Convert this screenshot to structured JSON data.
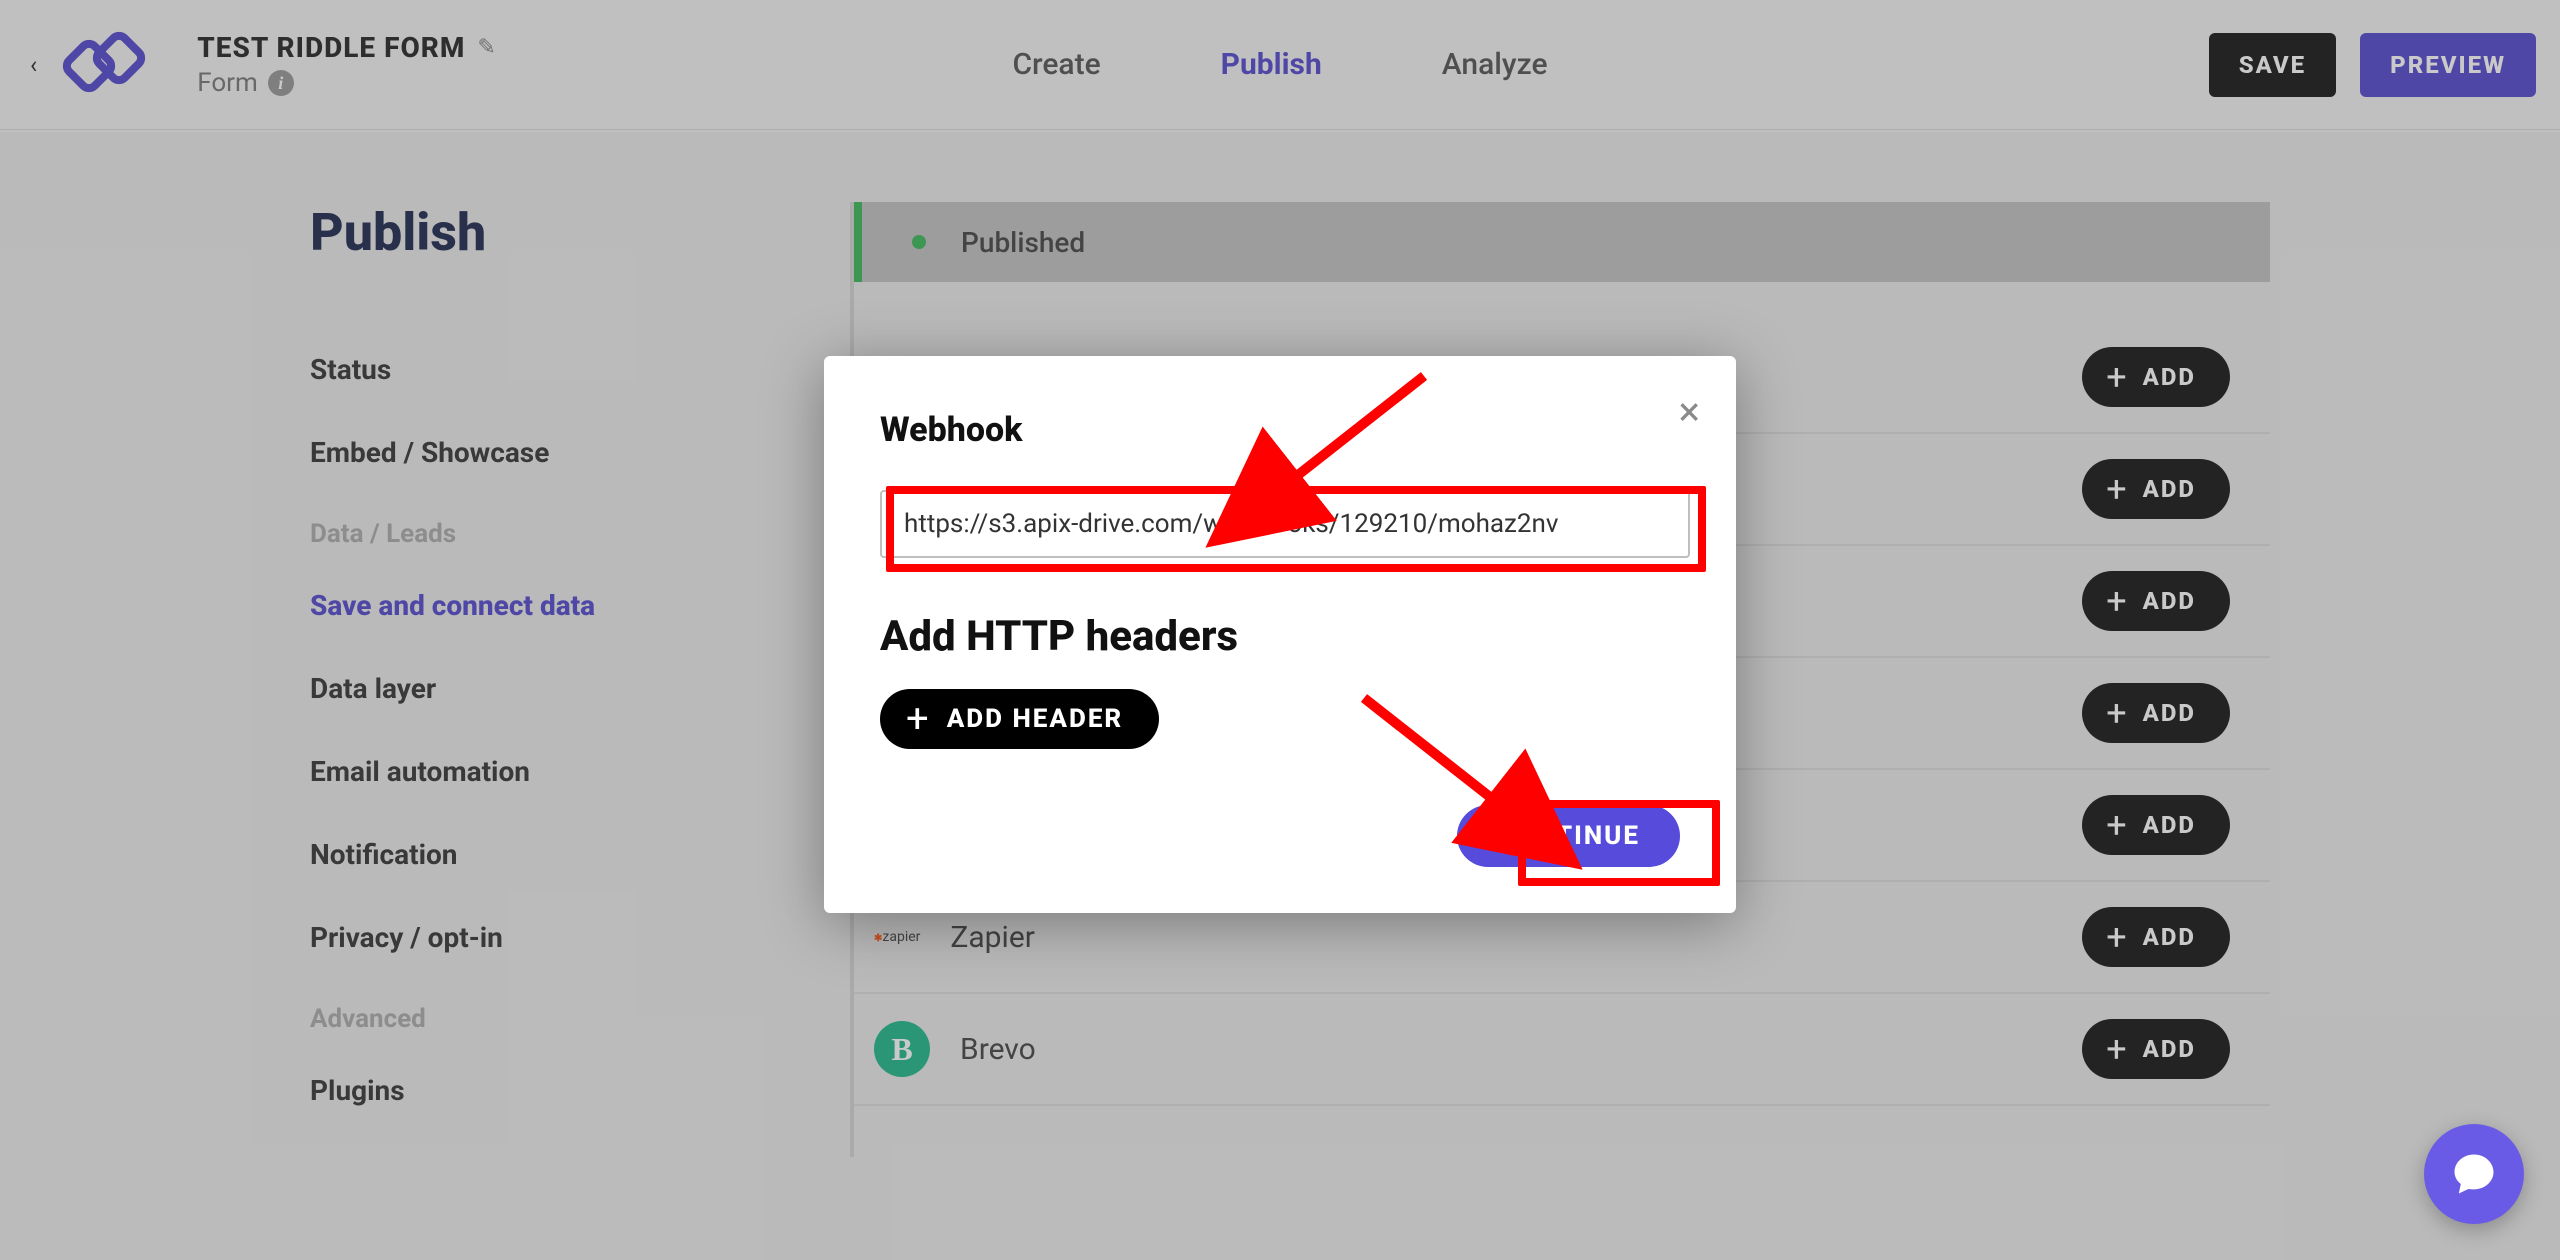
{
  "header": {
    "form_title": "TEST RIDDLE FORM",
    "form_type": "Form",
    "tabs": {
      "create": "Create",
      "publish": "Publish",
      "analyze": "Analyze"
    },
    "save": "SAVE",
    "preview": "PREVIEW"
  },
  "page_title": "Publish",
  "sidebar": {
    "items": [
      {
        "label": "Status"
      },
      {
        "label": "Embed / Showcase"
      }
    ],
    "section_data": "Data / Leads",
    "data_items": [
      {
        "label": "Save and connect data",
        "active": true
      },
      {
        "label": "Data layer"
      },
      {
        "label": "Email automation"
      },
      {
        "label": "Notification"
      },
      {
        "label": "Privacy / opt-in"
      }
    ],
    "section_advanced": "Advanced",
    "advanced_items": [
      {
        "label": "Plugins"
      }
    ]
  },
  "status_bar": {
    "text": "Published"
  },
  "integrations": {
    "add_label": "ADD",
    "visible": [
      {
        "name": "Zapier",
        "icon": "zapier"
      },
      {
        "name": "Brevo",
        "icon": "brevo"
      }
    ]
  },
  "modal": {
    "title": "Webhook",
    "url_value": "https://s3.apix-drive.com/web-hooks/129210/mohaz2nv",
    "headers_title": "Add HTTP headers",
    "add_header": "ADD HEADER",
    "continue": "CONTINUE"
  }
}
